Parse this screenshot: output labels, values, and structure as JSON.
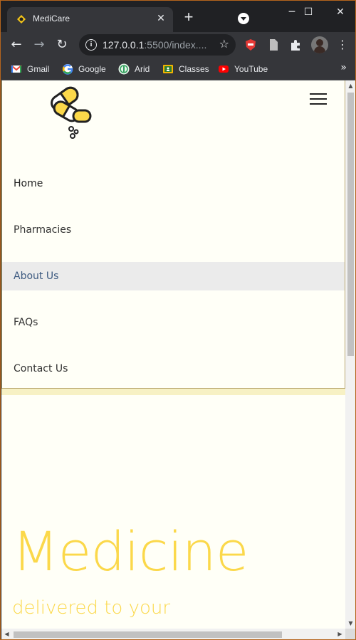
{
  "browser": {
    "tab": {
      "title": "MediCare",
      "close_label": "✕",
      "favicon": "medicare-favicon"
    },
    "new_tab_label": "+",
    "window_controls": {
      "minimize": "─",
      "maximize": "☐",
      "close": "✕"
    },
    "toolbar": {
      "back": "←",
      "forward": "→",
      "reload": "↻",
      "url_host": "127.0.0.1",
      "url_rest": ":5500/index....",
      "star": "☆",
      "menu": "⋮"
    },
    "bookmarks": [
      {
        "label": "Gmail",
        "icon": "gmail-icon",
        "color": "#ea4335"
      },
      {
        "label": "Google",
        "icon": "google-icon",
        "color": "#4285f4"
      },
      {
        "label": "Arid",
        "icon": "arid-icon",
        "color": "#2e9e5b"
      },
      {
        "label": "Classes",
        "icon": "classroom-icon",
        "color": "#f4b400"
      },
      {
        "label": "YouTube",
        "icon": "youtube-icon",
        "color": "#ff0000"
      }
    ],
    "bookmarks_more": "»"
  },
  "site": {
    "logo": "medicare-pills-logo",
    "menu_button": "hamburger-menu-icon",
    "nav": [
      {
        "label": "Home",
        "state": "active"
      },
      {
        "label": "Pharmacies",
        "state": "normal"
      },
      {
        "label": "About Us",
        "state": "hover"
      },
      {
        "label": "FAQs",
        "state": "normal"
      },
      {
        "label": "Contact Us",
        "state": "normal"
      }
    ],
    "hero": {
      "title": "Medicine",
      "subtitle": "delivered to your"
    },
    "colors": {
      "accent": "#fbd84a",
      "background": "#fffff7",
      "hover_bg": "#ebebeb",
      "hover_text": "#3d5a80"
    }
  }
}
